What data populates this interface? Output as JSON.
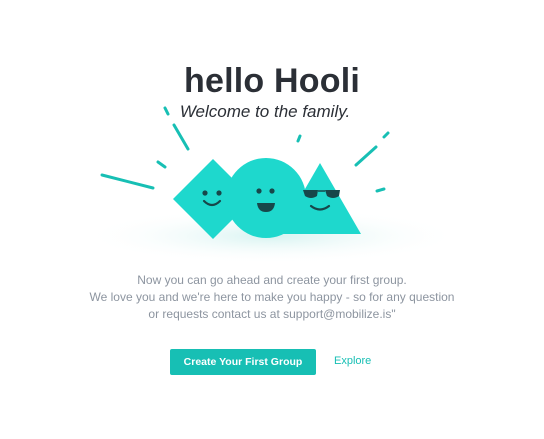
{
  "welcome": {
    "title": "hello Hooli",
    "subtitle": "Welcome to the family."
  },
  "message": {
    "line1": "Now you can go ahead and create your first group.",
    "line2": "We love you and we're here to make you happy - so for any question",
    "line3": "or requests contact us at support@mobilize.is\""
  },
  "actions": {
    "primary_label": "Create Your First Group",
    "secondary_label": "Explore"
  },
  "colors": {
    "accent": "#17bfb4",
    "shape_fill": "#1ed8cd",
    "title": "#2b2f36",
    "body_text": "#8d95a0"
  }
}
